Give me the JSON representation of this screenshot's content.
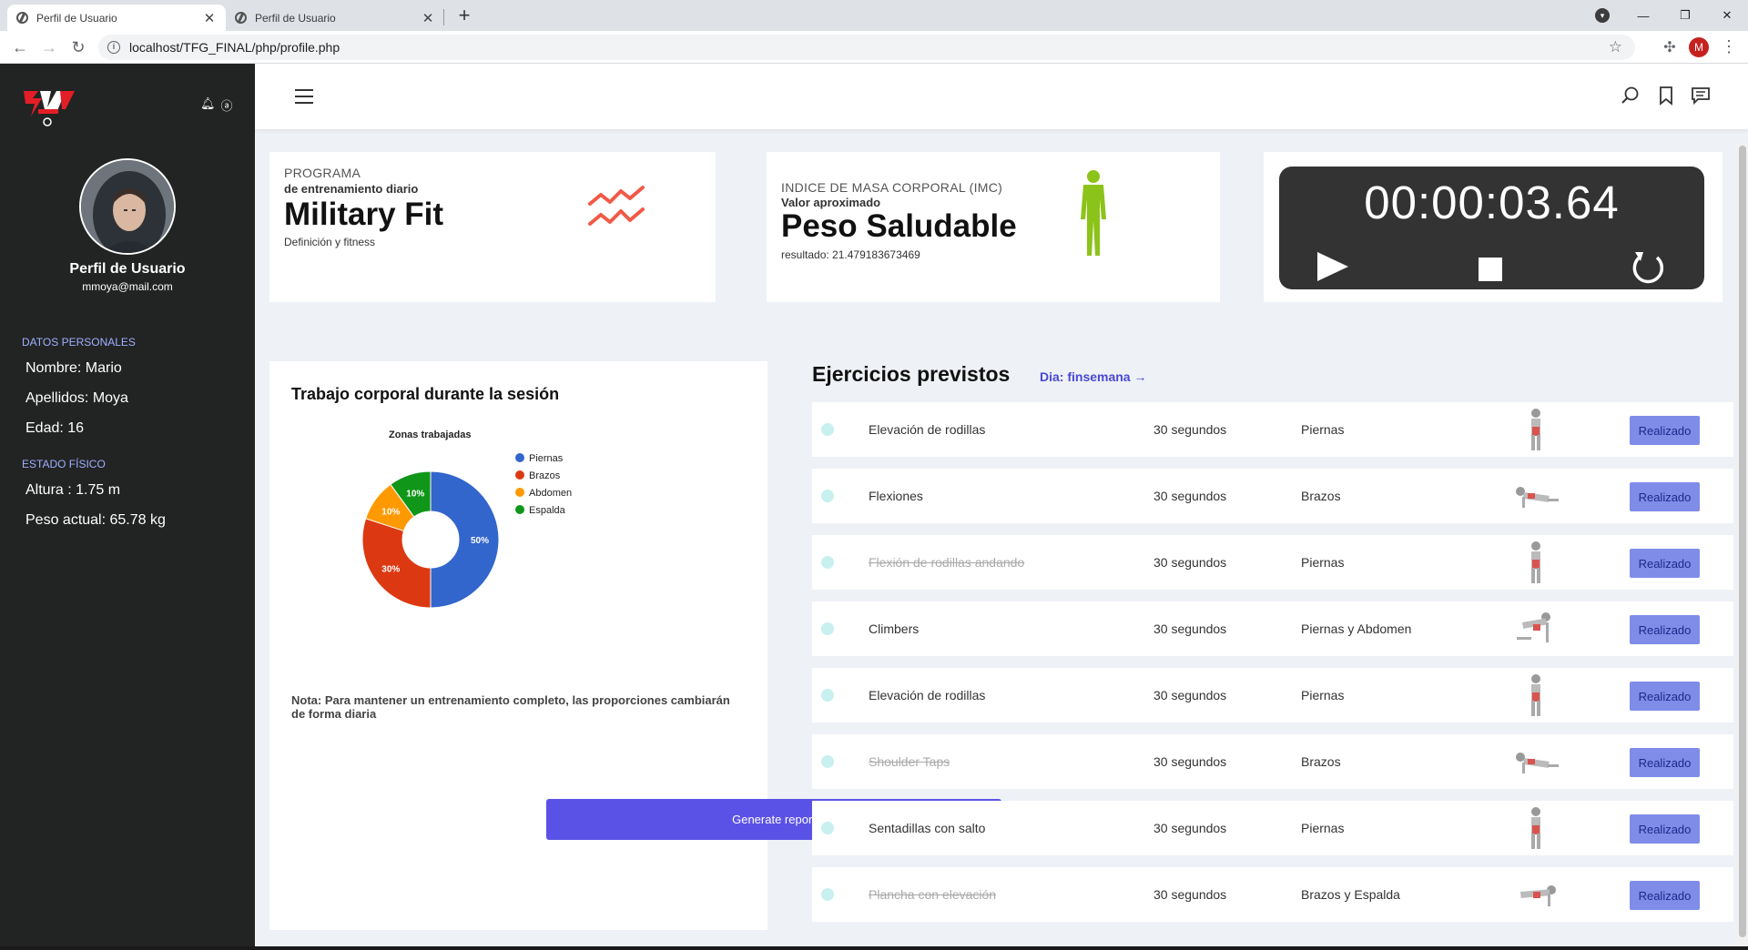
{
  "browser": {
    "tabs": [
      {
        "title": "Perfil de Usuario",
        "active": true
      },
      {
        "title": "Perfil de Usuario",
        "active": false
      }
    ],
    "new_tab": "+",
    "url": "localhost/TFG_FINAL/php/profile.php",
    "profile_initial": "M",
    "window_controls": {
      "minimize": "—",
      "restore": "❐",
      "close": "✕"
    }
  },
  "sidebar": {
    "user_name": "Perfil de Usuario",
    "email": "mmoya@mail.com",
    "sections": [
      {
        "title": "DATOS PERSONALES",
        "lines": [
          "Nombre: Mario",
          "Apellidos: Moya",
          "Edad: 16"
        ]
      },
      {
        "title": "ESTADO FÍSICO",
        "lines": [
          "Altura : 1.75 m",
          "Peso actual: 65.78 kg"
        ]
      }
    ]
  },
  "program_card": {
    "label": "PROGRAMA",
    "sub": "de entrenamiento diario",
    "name": "Military Fit",
    "desc": "Definición y fitness"
  },
  "imc_card": {
    "label": "INDICE DE MASA CORPORAL (IMC)",
    "sub": "Valor aproximado",
    "value": "Peso Saludable",
    "result": "resultado: 21.479183673469"
  },
  "timer": {
    "value": "00:00:03.64"
  },
  "chart_card": {
    "title": "Trabajo corporal durante la sesión",
    "note": "Nota: Para mantener un entrenamiento completo, las proporciones cambiarán de forma diaria",
    "button": "Generate report"
  },
  "chart_data": {
    "type": "pie",
    "title": "Zonas trabajadas",
    "donut": true,
    "legend_position": "right",
    "categories": [
      "Piernas",
      "Brazos",
      "Abdomen",
      "Espalda"
    ],
    "values": [
      50,
      30,
      10,
      10
    ],
    "labels": [
      "50%",
      "30%",
      "10%",
      "10%"
    ],
    "colors": [
      "#3366cc",
      "#dc3912",
      "#ff9900",
      "#109618"
    ]
  },
  "exercises": {
    "title": "Ejercicios previstos",
    "day_link": "Dia: finsemana →",
    "button_label": "Realizado",
    "rows": [
      {
        "name": "Elevación de rodillas",
        "duration": "30 segundos",
        "zone": "Piernas",
        "done": false
      },
      {
        "name": "Flexiones",
        "duration": "30 segundos",
        "zone": "Brazos",
        "done": false
      },
      {
        "name": "Flexión de rodillas andando",
        "duration": "30 segundos",
        "zone": "Piernas",
        "done": true
      },
      {
        "name": "Climbers",
        "duration": "30 segundos",
        "zone": "Piernas y Abdomen",
        "done": false
      },
      {
        "name": "Elevación de rodillas",
        "duration": "30 segundos",
        "zone": "Piernas",
        "done": false
      },
      {
        "name": "Shoulder Taps",
        "duration": "30 segundos",
        "zone": "Brazos",
        "done": true
      },
      {
        "name": "Sentadillas con salto",
        "duration": "30 segundos",
        "zone": "Piernas",
        "done": false
      },
      {
        "name": "Plancha con elevación",
        "duration": "30 segundos",
        "zone": "Brazos y Espalda",
        "done": true
      }
    ]
  }
}
